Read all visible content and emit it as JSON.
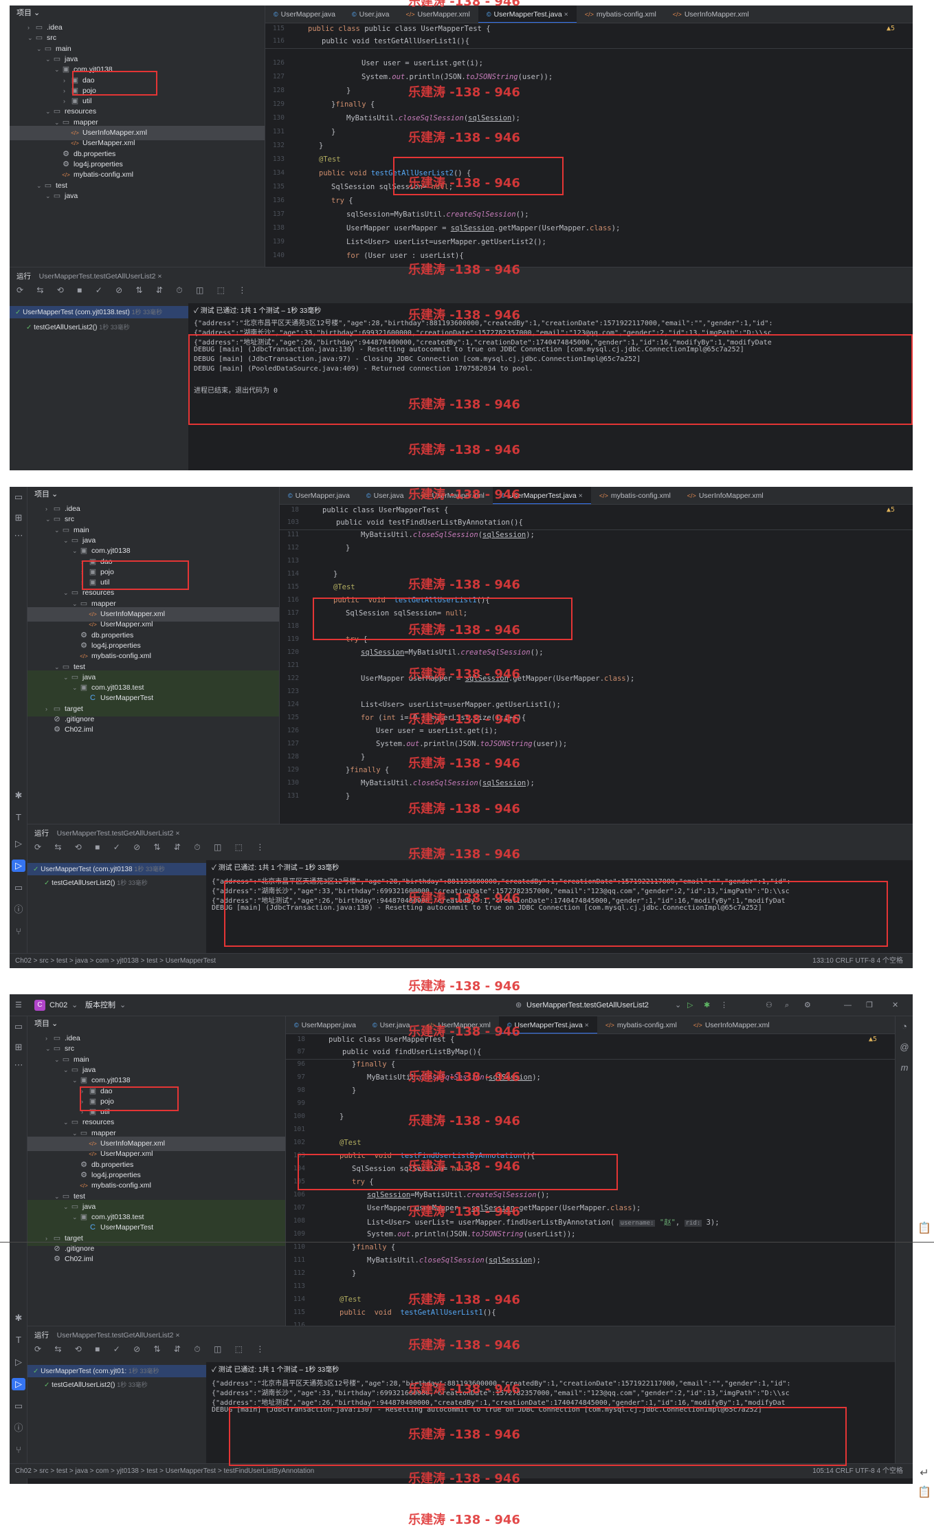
{
  "watermark": "乐建涛 -138 - 946",
  "panel1": {
    "tabs": [
      "UserMapper.java",
      "User.java",
      "UserMapper.xml",
      "UserMapperTest.java",
      "mybatis-config.xml",
      "UserInfoMapper.xml"
    ],
    "project_header": "项目",
    "tree": [
      {
        "label": ".idea",
        "icon": "folder"
      },
      {
        "label": "src",
        "icon": "folder"
      },
      {
        "label": "main",
        "icon": "folder"
      },
      {
        "label": "java",
        "icon": "folder"
      },
      {
        "label": "com.yjt0138",
        "icon": "pkg"
      },
      {
        "label": "dao",
        "icon": "pkg"
      },
      {
        "label": "pojo",
        "icon": "pkg"
      },
      {
        "label": "util",
        "icon": "pkg"
      },
      {
        "label": "resources",
        "icon": "folder"
      },
      {
        "label": "mapper",
        "icon": "folder"
      },
      {
        "label": "UserInfoMapper.xml",
        "icon": "xml"
      },
      {
        "label": "UserMapper.xml",
        "icon": "xml"
      },
      {
        "label": "db.properties",
        "icon": "props"
      },
      {
        "label": "log4j.properties",
        "icon": "props"
      },
      {
        "label": "mybatis-config.xml",
        "icon": "xml"
      },
      {
        "label": "test",
        "icon": "folder"
      },
      {
        "label": "java",
        "icon": "folder"
      }
    ],
    "sticky1": "public class UserMapperTest {",
    "sticky2": "public void testGetAllUserList1(){",
    "sticky_lines": [
      "115",
      "116"
    ],
    "warnings": "▲5",
    "lines": [
      "126",
      "127",
      "128",
      "129",
      "130",
      "131",
      "132",
      "133",
      "134",
      "135",
      "136",
      "137",
      "138",
      "139",
      "140"
    ],
    "run_label": "运行",
    "run_tab": "UserMapperTest.testGetAllUserList2",
    "run_tree": [
      {
        "label": "UserMapperTest (com.yjt0138.test)",
        "time": "1秒 33毫秒"
      },
      {
        "label": "testGetAllUserList2()",
        "time": "1秒 33毫秒"
      }
    ],
    "test_status": "✓ 测试 已通过: 1共 1 个测试 – 1秒 33毫秒",
    "console": [
      "{\"address\":\"北京市昌平区天通苑3区12号楼\",\"age\":28,\"birthday\":881193600000,\"createdBy\":1,\"creationDate\":1571922117000,\"email\":\"\",\"gender\":1,\"id\":",
      "{\"address\":\"湖南长沙\",\"age\":33,\"birthday\":699321600000,\"creationDate\":1572782357000,\"email\":\"123@qq.com\",\"gender\":2,\"id\":13,\"imgPath\":\"D:\\\\sc",
      "{\"address\":\"地址测试\",\"age\":26,\"birthday\":944870400000,\"createdBy\":1,\"creationDate\":1740474845000,\"gender\":1,\"id\":16,\"modifyBy\":1,\"modifyDate",
      "DEBUG [main] (JdbcTransaction.java:130) - Resetting autocommit to true on JDBC Connection [com.mysql.cj.jdbc.ConnectionImpl@65c7a252]",
      "DEBUG [main] (JdbcTransaction.java:97) - Closing JDBC Connection [com.mysql.cj.jdbc.ConnectionImpl@65c7a252]",
      "DEBUG [main] (PooledDataSource.java:409) - Returned connection 1707582034 to pool.",
      "",
      "进程已结束，退出代码为 0"
    ]
  },
  "panel2": {
    "tabs": [
      "UserMapper.java",
      "User.java",
      "UserMapper.xml",
      "UserMapperTest.java",
      "mybatis-config.xml",
      "UserInfoMapper.xml"
    ],
    "project_header": "项目",
    "tree": [
      {
        "label": ".idea",
        "icon": "folder"
      },
      {
        "label": "src",
        "icon": "folder"
      },
      {
        "label": "main",
        "icon": "folder"
      },
      {
        "label": "java",
        "icon": "folder"
      },
      {
        "label": "com.yjt0138",
        "icon": "pkg"
      },
      {
        "label": "dao",
        "icon": "pkg"
      },
      {
        "label": "pojo",
        "icon": "pkg"
      },
      {
        "label": "util",
        "icon": "pkg"
      },
      {
        "label": "resources",
        "icon": "folder"
      },
      {
        "label": "mapper",
        "icon": "folder"
      },
      {
        "label": "UserInfoMapper.xml",
        "icon": "xml"
      },
      {
        "label": "UserMapper.xml",
        "icon": "xml"
      },
      {
        "label": "db.properties",
        "icon": "props"
      },
      {
        "label": "log4j.properties",
        "icon": "props"
      },
      {
        "label": "mybatis-config.xml",
        "icon": "xml"
      },
      {
        "label": "test",
        "icon": "folder"
      },
      {
        "label": "java",
        "icon": "folder"
      },
      {
        "label": "com.yjt0138.test",
        "icon": "pkg"
      },
      {
        "label": "UserMapperTest",
        "icon": "java"
      },
      {
        "label": "target",
        "icon": "folder"
      },
      {
        "label": ".gitignore",
        "icon": "git"
      },
      {
        "label": "Ch02.iml",
        "icon": "props"
      }
    ],
    "sticky1": "public class UserMapperTest {",
    "sticky2": "public void testFindUserListByAnnotation(){",
    "sticky_lines": [
      "18",
      "103"
    ],
    "warnings": "▲5",
    "lines": [
      "111",
      "112",
      "113",
      "114",
      "115",
      "116",
      "117",
      "118",
      "119",
      "120",
      "121",
      "122",
      "123",
      "124",
      "125",
      "126",
      "127",
      "128",
      "129",
      "130",
      "131"
    ],
    "run_label": "运行",
    "run_tab": "UserMapperTest.testGetAllUserList2",
    "run_tree": [
      {
        "label": "UserMapperTest (com.yjt0138",
        "time": "1秒 33毫秒"
      },
      {
        "label": "testGetAllUserList2()",
        "time": "1秒 33毫秒"
      }
    ],
    "test_status": "✓ 测试 已通过: 1共 1 个测试 – 1秒 33毫秒",
    "console": [
      "{\"address\":\"北京市昌平区天通苑3区12号楼\",\"age\":28,\"birthday\":881193600000,\"createdBy\":1,\"creationDate\":1571922117000,\"email\":\"\",\"gender\":1,\"id\":",
      "{\"address\":\"湖南长沙\",\"age\":33,\"birthday\":699321600000,\"creationDate\":1572782357000,\"email\":\"123@qq.com\",\"gender\":2,\"id\":13,\"imgPath\":\"D:\\\\sc",
      "{\"address\":\"地址测试\",\"age\":26,\"birthday\":944870400000,\"createdBy\":1,\"creationDate\":1740474845000,\"gender\":1,\"id\":16,\"modifyBy\":1,\"modifyDat",
      "DEBUG [main] (JdbcTransaction.java:130) - Resetting autocommit to true on JDBC Connection [com.mysql.cj.jdbc.ConnectionImpl@65c7a252]"
    ],
    "status_path": "Ch02 > src > test > java > com > yjt0138 > test > UserMapperTest",
    "status_right": "133:10   CRLF   UTF-8   4 个空格"
  },
  "panel3": {
    "project_name": "Ch02",
    "vcs": "版本控制",
    "run_config": "UserMapperTest.testGetAllUserList2",
    "tabs": [
      "UserMapper.java",
      "User.java",
      "UserMapper.xml",
      "UserMapperTest.java",
      "mybatis-config.xml",
      "UserInfoMapper.xml"
    ],
    "project_header": "项目",
    "tree": [
      {
        "label": ".idea",
        "icon": "folder"
      },
      {
        "label": "src",
        "icon": "folder"
      },
      {
        "label": "main",
        "icon": "folder"
      },
      {
        "label": "java",
        "icon": "folder"
      },
      {
        "label": "com.yjt0138",
        "icon": "pkg"
      },
      {
        "label": "dao",
        "icon": "pkg"
      },
      {
        "label": "pojo",
        "icon": "pkg"
      },
      {
        "label": "util",
        "icon": "pkg"
      },
      {
        "label": "resources",
        "icon": "folder"
      },
      {
        "label": "mapper",
        "icon": "folder"
      },
      {
        "label": "UserInfoMapper.xml",
        "icon": "xml"
      },
      {
        "label": "UserMapper.xml",
        "icon": "xml"
      },
      {
        "label": "db.properties",
        "icon": "props"
      },
      {
        "label": "log4j.properties",
        "icon": "props"
      },
      {
        "label": "mybatis-config.xml",
        "icon": "xml"
      },
      {
        "label": "test",
        "icon": "folder"
      },
      {
        "label": "java",
        "icon": "folder"
      },
      {
        "label": "com.yjt0138.test",
        "icon": "pkg"
      },
      {
        "label": "UserMapperTest",
        "icon": "java"
      },
      {
        "label": "target",
        "icon": "folder"
      },
      {
        "label": ".gitignore",
        "icon": "git"
      },
      {
        "label": "Ch02.iml",
        "icon": "props"
      }
    ],
    "sticky1": "public class UserMapperTest {",
    "sticky2": "public void findUserListByMap(){",
    "sticky_lines": [
      "18",
      "87"
    ],
    "warnings": "▲5",
    "lines": [
      "96",
      "97",
      "98",
      "99",
      "100",
      "101",
      "102",
      "103",
      "104",
      "105",
      "106",
      "107",
      "108",
      "109",
      "110",
      "111",
      "112",
      "113",
      "114",
      "115",
      "116"
    ],
    "param_hint_1": "username:",
    "param_hint_2": "rid:",
    "run_label": "运行",
    "run_tab": "UserMapperTest.testGetAllUserList2",
    "run_tree": [
      {
        "label": "UserMapperTest (com.yjt01:",
        "time": "1秒 33毫秒"
      },
      {
        "label": "testGetAllUserList2()",
        "time": "1秒 33毫秒"
      }
    ],
    "test_status": "✓ 测试 已通过: 1共 1 个测试 – 1秒 33毫秒",
    "console": [
      "{\"address\":\"北京市昌平区天通苑3区12号楼\",\"age\":28,\"birthday\":881193600000,\"createdBy\":1,\"creationDate\":1571922117000,\"email\":\"\",\"gender\":1,\"id\":",
      "{\"address\":\"湖南长沙\",\"age\":33,\"birthday\":699321600000,\"creationDate\":1572782357000,\"email\":\"123@qq.com\",\"gender\":2,\"id\":13,\"imgPath\":\"D:\\\\sc",
      "{\"address\":\"地址测试\",\"age\":26,\"birthday\":944870400000,\"createdBy\":1,\"creationDate\":1740474845000,\"gender\":1,\"id\":16,\"modifyBy\":1,\"modifyDat",
      "DEBUG [main] (JdbcTransaction.java:130) - Resetting autocommit to true on JDBC Connection [com.mysql.cj.jdbc.ConnectionImpl@65c7a252]"
    ],
    "status_path": "Ch02 > src > test > java > com > yjt0138 > test > UserMapperTest > testFindUserListByAnnotation",
    "status_right": "105:14   CRLF   UTF-8   4 个空格"
  }
}
